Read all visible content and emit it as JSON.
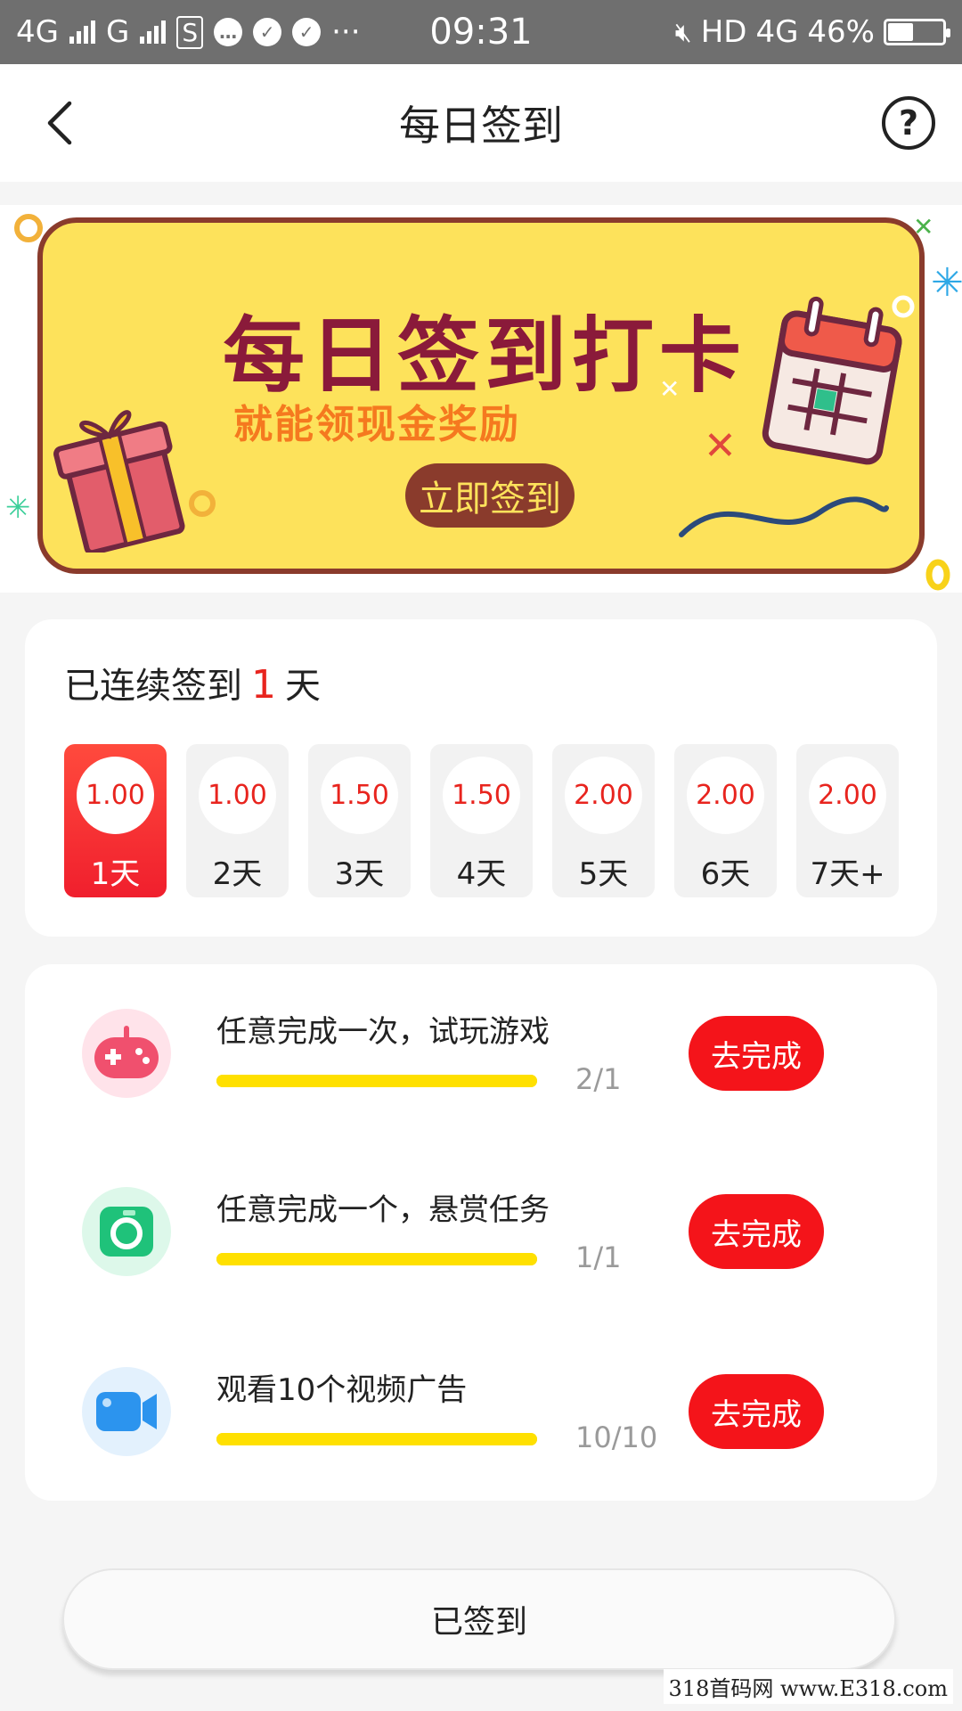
{
  "status_bar": {
    "network_left": "4G",
    "network_right": "G",
    "time": "09:31",
    "hd": "HD",
    "net_type": "4G",
    "battery": "46%",
    "battery_level": 0.46
  },
  "header": {
    "title": "每日签到",
    "help_symbol": "?"
  },
  "banner": {
    "title": "每日签到打卡",
    "subtitle": "就能领现金奖励",
    "button_label": "立即签到"
  },
  "sign": {
    "title_prefix": "已连续签到",
    "streak": "1",
    "title_suffix": "天",
    "days": [
      {
        "amount": "1.00",
        "label": "1天",
        "active": true
      },
      {
        "amount": "1.00",
        "label": "2天",
        "active": false
      },
      {
        "amount": "1.50",
        "label": "3天",
        "active": false
      },
      {
        "amount": "1.50",
        "label": "4天",
        "active": false
      },
      {
        "amount": "2.00",
        "label": "5天",
        "active": false
      },
      {
        "amount": "2.00",
        "label": "6天",
        "active": false
      },
      {
        "amount": "2.00",
        "label": "7天+",
        "active": false
      }
    ]
  },
  "tasks": [
    {
      "title": "任意完成一次，试玩游戏",
      "progress": "2/1",
      "progress_fraction": 1.0,
      "button": "去完成",
      "icon": "gamepad-icon"
    },
    {
      "title": "任意完成一个，悬赏任务",
      "progress": "1/1",
      "progress_fraction": 1.0,
      "button": "去完成",
      "icon": "camera-icon"
    },
    {
      "title": "观看10个视频广告",
      "progress": "10/10",
      "progress_fraction": 1.0,
      "button": "去完成",
      "icon": "video-icon"
    }
  ],
  "footer": {
    "signed_label": "已签到"
  },
  "watermark": "318首码网 www.E318.com",
  "colors": {
    "accent_red": "#f4141a",
    "banner_yellow": "#fde25b",
    "progress_yellow": "#ffe000"
  }
}
